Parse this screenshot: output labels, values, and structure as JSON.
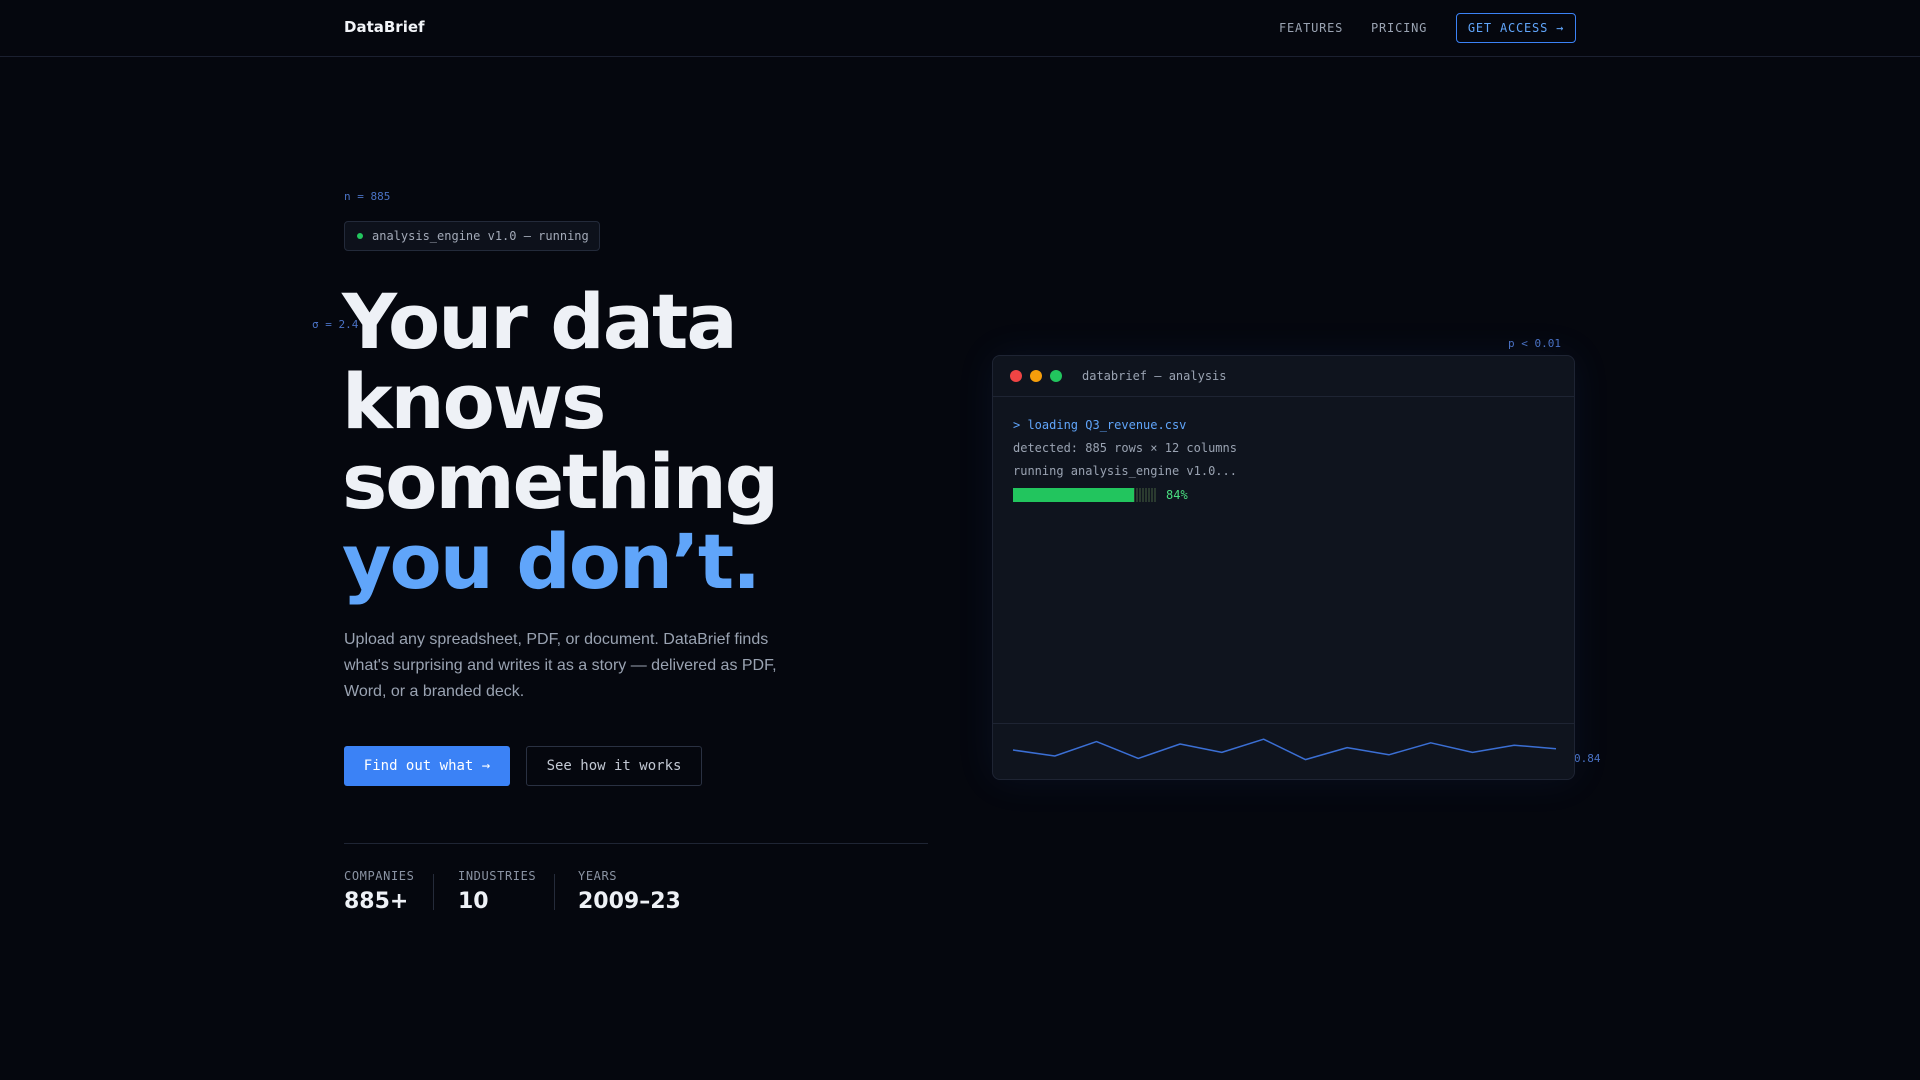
{
  "nav": {
    "logo": "DataBrief",
    "links": [
      "FEATURES",
      "PRICING"
    ],
    "cta": "GET ACCESS →"
  },
  "annotations": {
    "n": "n = 885",
    "sigma": "σ = 2.4",
    "p": "p < 0.01",
    "r": "0.84"
  },
  "badge": {
    "status_color": "#22c55e",
    "text": "analysis_engine v1.0 — running"
  },
  "hero": {
    "headline": [
      "Your data",
      "knows",
      "something"
    ],
    "headline_accent": "you don’t.",
    "subtitle": "Upload any spreadsheet, PDF, or document. DataBrief finds what's surprising and writes it as a story — delivered as PDF, Word, or a branded deck.",
    "primary_button": "Find out what →",
    "secondary_button": "See how it works"
  },
  "stats": [
    {
      "label": "COMPANIES",
      "value": "885+"
    },
    {
      "label": "INDUSTRIES",
      "value": "10"
    },
    {
      "label": "YEARS",
      "value": "2009–23"
    }
  ],
  "terminal": {
    "title": "databrief — analysis",
    "lines": [
      "> loading Q3_revenue.csv",
      "detected: 885 rows × 12 columns",
      "running analysis_engine v1.0..."
    ],
    "progress": 0.84,
    "progress_label": "84%",
    "sparkline": [
      0.5,
      0.25,
      0.85,
      0.15,
      0.75,
      0.4,
      0.95,
      0.1,
      0.6,
      0.3,
      0.8,
      0.4,
      0.7,
      0.55
    ]
  },
  "colors": {
    "accent": "#3b82f6",
    "accent_light": "#60a5fa",
    "success": "#22c55e",
    "background": "#05070e"
  }
}
